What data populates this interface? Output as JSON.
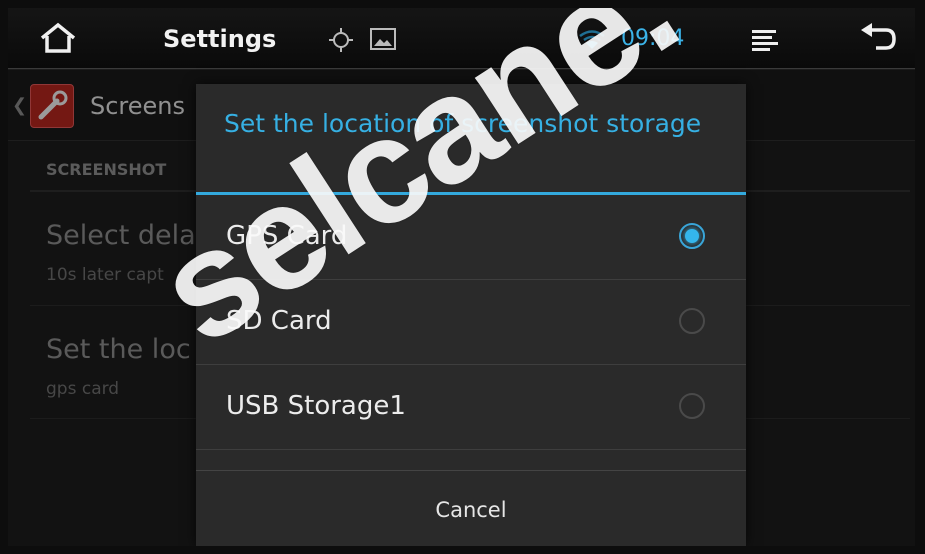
{
  "topbar": {
    "title": "Settings",
    "time": "09:04",
    "icons": [
      "home-icon",
      "gps-icon",
      "gallery-icon",
      "wifi-icon",
      "menu-icon",
      "back-icon"
    ]
  },
  "background": {
    "header_title": "Screens",
    "section_label": "SCREENSHOT",
    "rows": [
      {
        "title": "Select dela",
        "subtitle": "10s later capt"
      },
      {
        "title": "Set the loc",
        "subtitle": "gps card"
      }
    ]
  },
  "dialog": {
    "title": "Set the location of screenshot storage",
    "options": [
      {
        "label": "GPS Card",
        "selected": true
      },
      {
        "label": "SD Card",
        "selected": false
      },
      {
        "label": "USB Storage1",
        "selected": false
      }
    ],
    "cancel_label": "Cancel"
  },
  "watermark": "selcane.",
  "colors": {
    "accent": "#36b0e3",
    "background": "#1c1c1c"
  }
}
